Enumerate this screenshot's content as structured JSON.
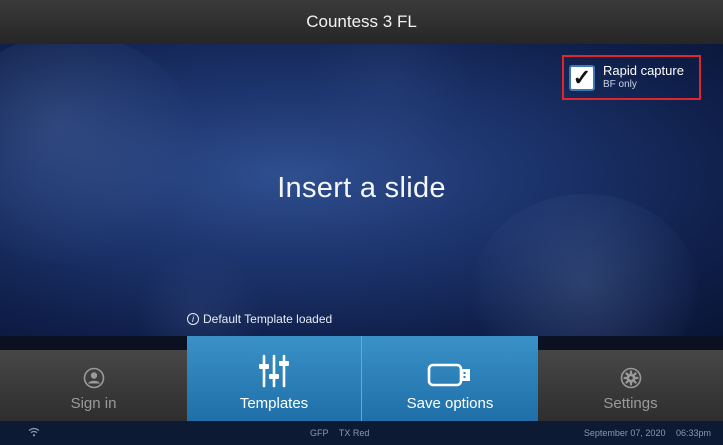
{
  "title": "Countess 3 FL",
  "rapid_capture": {
    "label": "Rapid capture",
    "sublabel": "BF only",
    "checked": true
  },
  "main_message": "Insert a slide",
  "status_message": "Default Template loaded",
  "nav": {
    "sign_in": "Sign in",
    "templates": "Templates",
    "save_options": "Save options",
    "settings": "Settings"
  },
  "footer": {
    "channels": [
      "GFP",
      "TX Red"
    ],
    "date": "September 07, 2020",
    "time": "06:33pm"
  },
  "colors": {
    "accent_blue": "#2a80bd",
    "highlight_red": "#e0262b"
  },
  "icons": [
    "user-icon",
    "sliders-icon",
    "usb-drive-icon",
    "gear-icon",
    "wifi-icon",
    "info-icon",
    "checkmark-icon"
  ]
}
